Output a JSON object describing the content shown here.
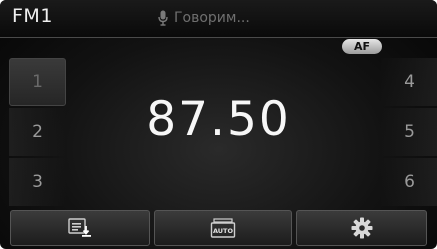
{
  "header": {
    "band": "FM1",
    "voice_icon": "microphone-icon",
    "voice_status": "Говорим..."
  },
  "af_badge": "AF",
  "frequency": "87.50",
  "presets": {
    "left": [
      "1",
      "2",
      "3"
    ],
    "right": [
      "4",
      "5",
      "6"
    ],
    "selected": "1"
  },
  "bottom_buttons": [
    {
      "icon": "list-download-icon"
    },
    {
      "icon": "auto-store-icon",
      "label": "AUTO"
    },
    {
      "icon": "gear-icon"
    }
  ],
  "colors": {
    "text": "#f0f0f0",
    "muted": "#9a9a9a",
    "background": "#121212",
    "badge": "#d8d8d8"
  }
}
